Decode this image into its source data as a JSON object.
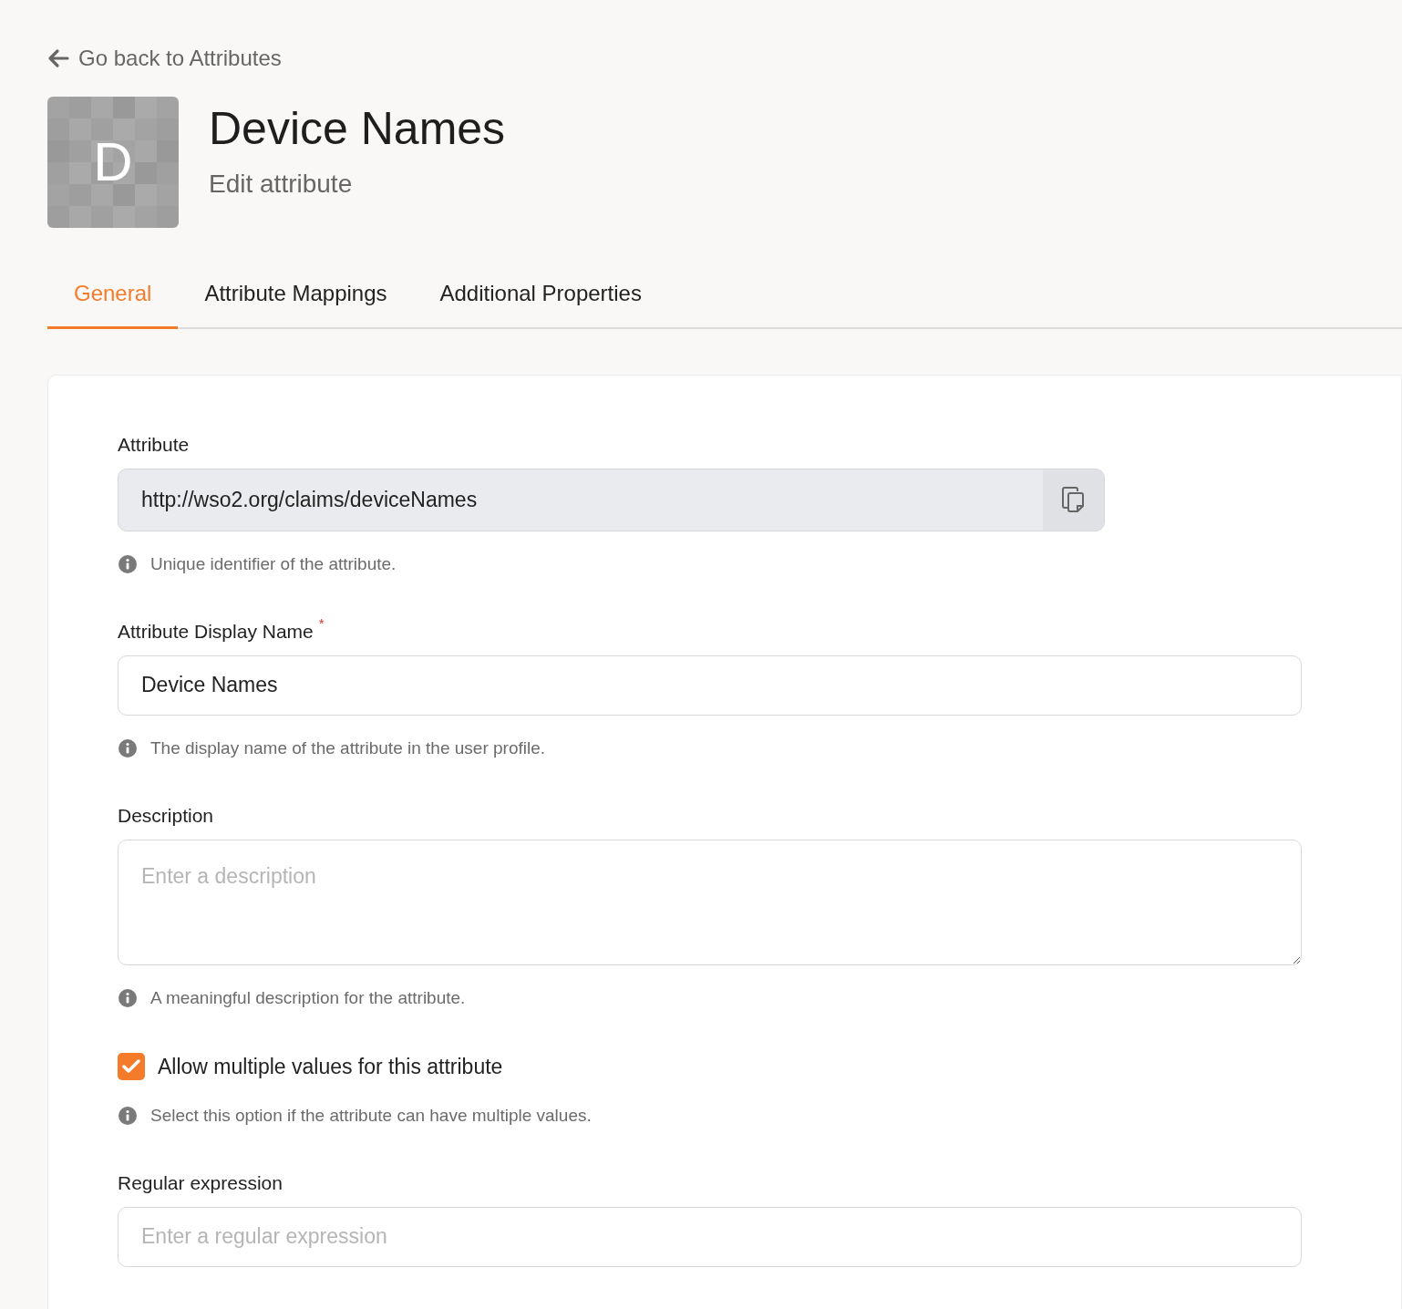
{
  "back_link": "Go back to Attributes",
  "header": {
    "avatar_letter": "D",
    "title": "Device Names",
    "subtitle": "Edit attribute"
  },
  "tabs": [
    {
      "label": "General",
      "selected": true
    },
    {
      "label": "Attribute Mappings",
      "selected": false
    },
    {
      "label": "Additional Properties",
      "selected": false
    }
  ],
  "form": [
    {
      "kind": "copy-field",
      "label": "Attribute",
      "value": "http://wso2.org/claims/deviceNames",
      "hint": "Unique identifier of the attribute."
    },
    {
      "kind": "input",
      "label": "Attribute Display Name",
      "value": "Device Names",
      "hint": "The display name of the attribute in the user profile.",
      "required_mark": "*"
    },
    {
      "kind": "textarea",
      "label": "Description",
      "placeholder": "Enter a description",
      "hint": "A meaningful description for the attribute."
    },
    {
      "kind": "checkbox",
      "label": "Allow multiple values for this attribute",
      "checked": true,
      "hint": "Select this option if the attribute can have multiple values."
    },
    {
      "kind": "input",
      "label": "Regular expression",
      "placeholder": "Enter a regular expression"
    }
  ]
}
